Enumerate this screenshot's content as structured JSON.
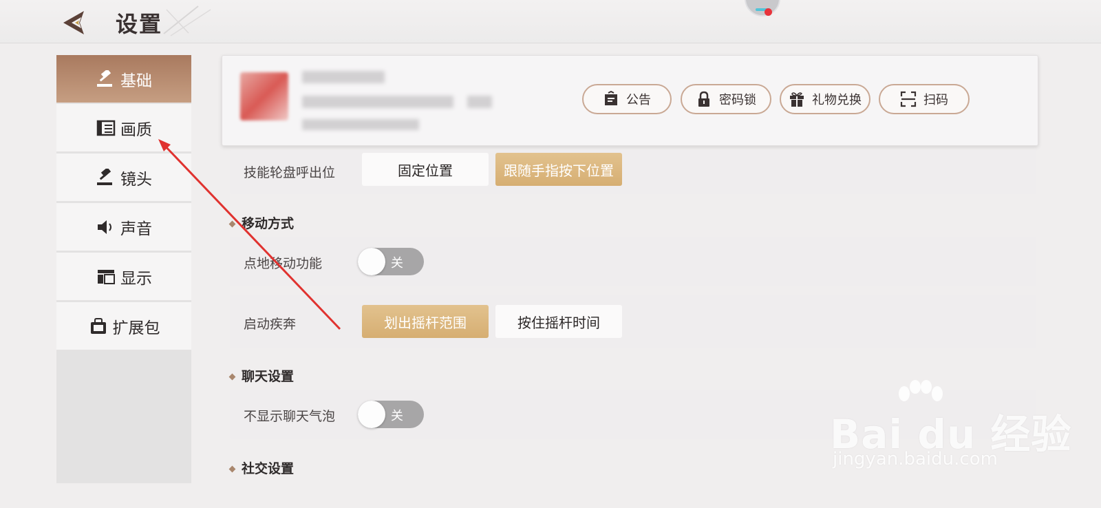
{
  "header": {
    "title": "设置"
  },
  "sidebar": {
    "items": [
      {
        "label": "基础",
        "icon": "gavel-icon",
        "active": true
      },
      {
        "label": "画质",
        "icon": "film-icon",
        "active": false
      },
      {
        "label": "镜头",
        "icon": "gavel-icon",
        "active": false
      },
      {
        "label": "声音",
        "icon": "speaker-icon",
        "active": false
      },
      {
        "label": "显示",
        "icon": "layout-icon",
        "active": false
      },
      {
        "label": "扩展包",
        "icon": "bag-icon",
        "active": false
      }
    ]
  },
  "profile": {
    "buttons": [
      {
        "label": "公告",
        "icon": "notice-board-icon"
      },
      {
        "label": "密码锁",
        "icon": "lock-icon"
      },
      {
        "label": "礼物兑换",
        "icon": "gift-icon"
      },
      {
        "label": "扫码",
        "icon": "scan-icon"
      }
    ]
  },
  "settings": {
    "skill_wheel": {
      "label": "技能轮盘呼出位",
      "options": [
        "固定位置",
        "跟随手指按下位置"
      ],
      "selected": "跟随手指按下位置"
    },
    "move_section": {
      "title": "移动方式"
    },
    "tap_move": {
      "label": "点地移动功能",
      "state": "关"
    },
    "sprint": {
      "label": "启动疾奔",
      "options": [
        "划出摇杆范围",
        "按住摇杆时间"
      ],
      "selected": "划出摇杆范围"
    },
    "chat_section": {
      "title": "聊天设置"
    },
    "hide_bubble": {
      "label": "不显示聊天气泡",
      "state": "关"
    },
    "social_section": {
      "title": "社交设置"
    }
  },
  "watermark": {
    "main": "Bai du 经验",
    "sub": "jingyan.baidu.com"
  },
  "colors": {
    "accent": "#c69e82",
    "option_selected": "#d6ae72",
    "toggle_off": "#a7a6a7",
    "annotation_arrow": "#e0322f"
  }
}
